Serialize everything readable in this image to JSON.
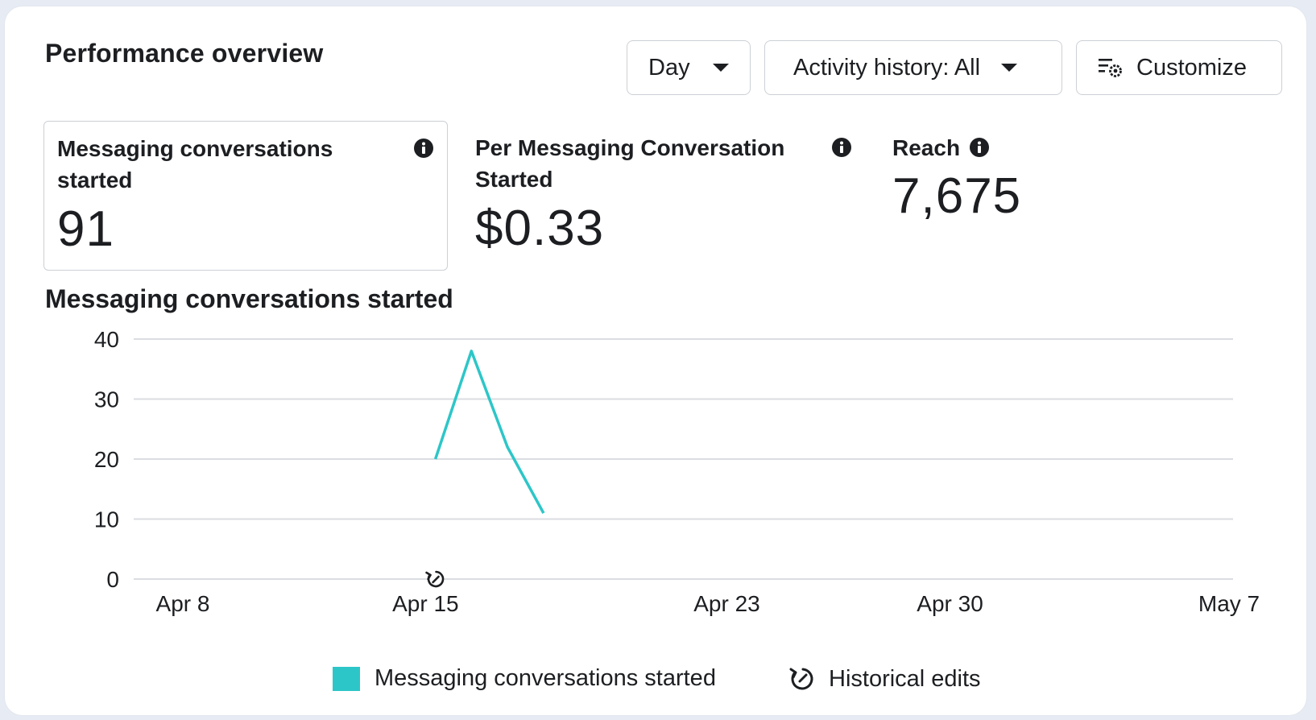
{
  "header": {
    "title": "Performance overview",
    "period_label": "Day",
    "activity_label": "Activity history: All",
    "customize_label": "Customize"
  },
  "metrics": [
    {
      "label": "Messaging conversations started",
      "value": "91",
      "selected": true
    },
    {
      "label": "Per Messaging Conversation Started",
      "value": "$0.33",
      "selected": false
    },
    {
      "label": "Reach",
      "value": "7,675",
      "selected": false
    }
  ],
  "chart_title": "Messaging conversations started",
  "legend": {
    "series_label": "Messaging conversations started",
    "edits_label": "Historical edits"
  },
  "colors": {
    "series": "#2dc6c8",
    "grid": "#dadde1"
  },
  "chart_data": {
    "type": "line",
    "title": "Messaging conversations started",
    "ylim": [
      0,
      40
    ],
    "yticks": [
      0,
      10,
      20,
      30,
      40
    ],
    "xticks": [
      "Apr 8",
      "Apr 15",
      "Apr 23",
      "Apr 30",
      "May 7"
    ],
    "xlim": [
      "2024-04-08",
      "2024-05-07"
    ],
    "grid": true,
    "legend_position": "bottom",
    "series": [
      {
        "name": "Messaging conversations started",
        "color": "#2dc6c8",
        "points": [
          {
            "x": "2024-04-15",
            "y": 20
          },
          {
            "x": "2024-04-16",
            "y": 38
          },
          {
            "x": "2024-04-17",
            "y": 22
          },
          {
            "x": "2024-04-18",
            "y": 11
          }
        ]
      }
    ],
    "annotations": [
      {
        "type": "historical-edit",
        "x": "2024-04-15"
      }
    ]
  }
}
